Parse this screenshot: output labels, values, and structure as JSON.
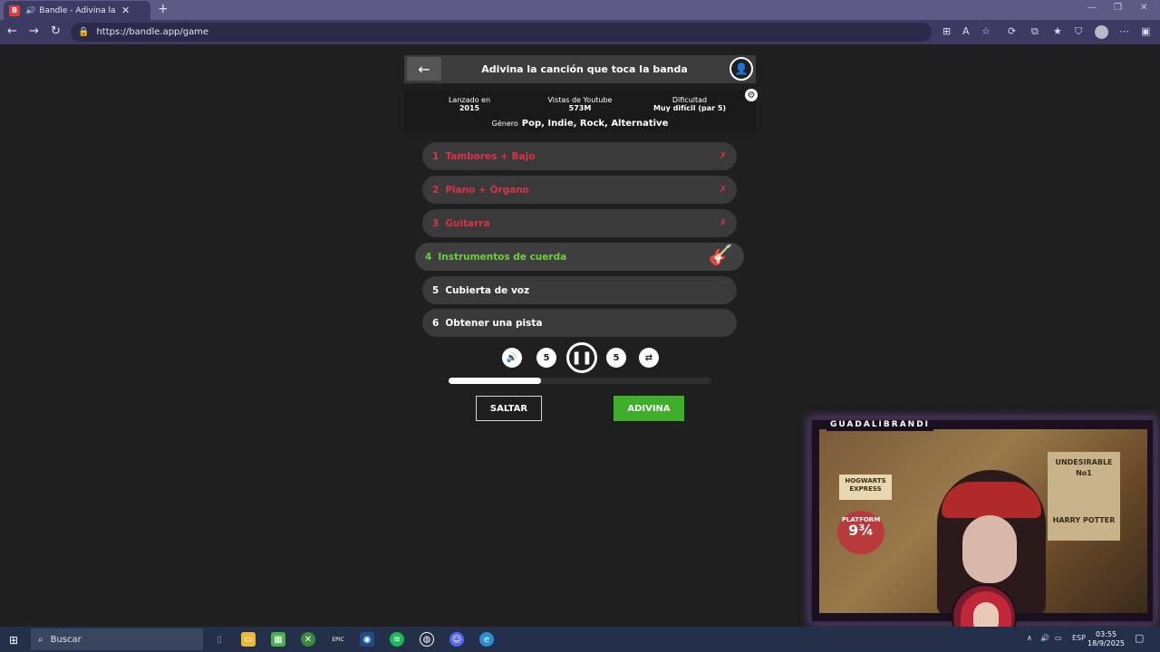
{
  "browser": {
    "tab_title": "Bandle - Adivina la canción,",
    "favicon_letter": "B",
    "url": "https://bandle.app/game"
  },
  "game": {
    "header_title": "Adivina la canción que toca la banda",
    "info": {
      "released_label": "Lanzado en",
      "released_value": "2015",
      "views_label": "Vistas de Youtube",
      "views_value": "573M",
      "difficulty_label": "Dificultad",
      "difficulty_value": "Muy difícil (par 5)",
      "genre_label": "Género",
      "genre_value": "Pop, Indie, Rock, Alternative"
    },
    "rows": [
      {
        "num": "1",
        "label": "Tambores + Bajo",
        "state": "wrong"
      },
      {
        "num": "2",
        "label": "Piano + Órgano",
        "state": "wrong"
      },
      {
        "num": "3",
        "label": "Guitarra",
        "state": "wrong"
      },
      {
        "num": "4",
        "label": "Instrumentos de cuerda",
        "state": "active"
      },
      {
        "num": "5",
        "label": "Cubierta de voz",
        "state": "pending"
      },
      {
        "num": "6",
        "label": "Obtener una pista",
        "state": "pending"
      }
    ],
    "rewind_seconds": "5",
    "forward_seconds": "5",
    "progress": 0.35,
    "skip_label": "SALTAR",
    "guess_label": "ADIVINA"
  },
  "stream": {
    "name": "GUADALIBRANDI",
    "sign_text": "HOGWARTS EXPRESS",
    "platform_word": "PLATFORM",
    "platform_number": "9¾",
    "poster_title": "UNDESIRABLE",
    "poster_no": "No1",
    "poster_name": "HARRY POTTER"
  },
  "taskbar": {
    "search_placeholder": "Buscar",
    "epic_label": "EPIC",
    "language": "ESP",
    "time": "03:55",
    "date": "18/9/2025"
  },
  "colors": {
    "wrong": "#d9334a",
    "active": "#6fcf3f",
    "guess_button": "#3fae2a"
  }
}
